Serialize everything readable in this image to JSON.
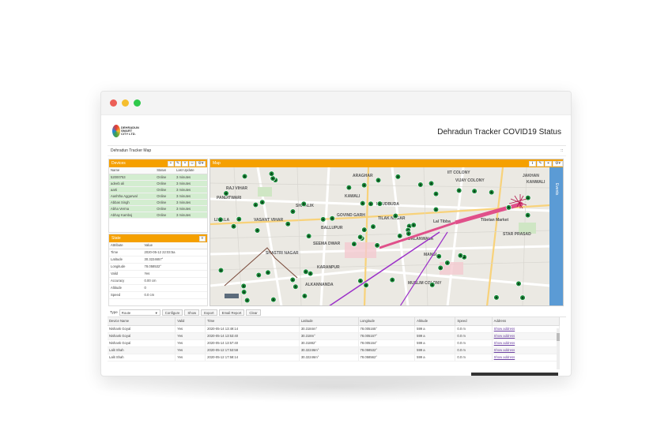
{
  "window": {
    "dots": [
      "#ec5f57",
      "#f5be2f",
      "#2fc94b"
    ]
  },
  "header": {
    "brand_line1": "DEHRADUN",
    "brand_line2": "SMART CITY LTD.",
    "title": "Dehradun Tracker COVID19 Status"
  },
  "subheader": {
    "title": "Dehradun Tracker Map",
    "expand_icon": "::"
  },
  "devices": {
    "title": "Devices",
    "columns": [
      "Name",
      "Status",
      "Last Update"
    ],
    "rows": [
      [
        "52000753",
        "Online",
        "3 minutes"
      ],
      [
        "adeeb ali",
        "Online",
        "3 minutes"
      ],
      [
        "aarti",
        "Online",
        "3 minutes"
      ],
      [
        "Aashtha Aggarwal",
        "Online",
        "3 minutes"
      ],
      [
        "Abbas Singh",
        "Online",
        "3 minutes"
      ],
      [
        "Abha Verma",
        "Online",
        "3 minutes"
      ],
      [
        "Abhay Kamboj",
        "Online",
        "3 minutes"
      ]
    ]
  },
  "state": {
    "title": "State",
    "columns": [
      "Attribute",
      "Value"
    ],
    "rows": [
      [
        "Time",
        "2020-05-12 22:03:5a"
      ],
      [
        "Latitude",
        "30.3224657°"
      ],
      [
        "Longitude",
        "78.058532°"
      ],
      [
        "Valid",
        "Yes"
      ],
      [
        "Accuracy",
        "0.00 cm"
      ],
      [
        "Altitude",
        "0"
      ],
      [
        "Speed",
        "0.0 cm"
      ]
    ]
  },
  "map": {
    "title": "Map",
    "events_label": "Events",
    "labels": [
      "JAKHAN",
      "RAJ VIHAR",
      "LIWALA",
      "VASANT VIHAR",
      "SHIVALIK",
      "PANDITWARI",
      "KAWALI",
      "GOVIND GARH",
      "TILAK NAGAR",
      "KANWALI",
      "BALLUPUR",
      "SHASTRI NAGAR",
      "ALKANNANDA",
      "KARANPUR",
      "DALANWALA",
      "MUSLIM COLONY",
      "MANSI",
      "ARAGHAR",
      "VIJAY COLONY",
      "SEEMA DWAR",
      "IIT COLONY",
      "STAR PRASAD",
      "Lal Tibba",
      "Tibetan Market",
      "KHUDBUDA"
    ]
  },
  "report": {
    "type_label": "Type",
    "type_value": "Route",
    "buttons": [
      "Configure",
      "Show",
      "Export",
      "Email Report",
      "Clear"
    ],
    "columns": [
      "Device Name",
      "Valid",
      "Time",
      "Latitude",
      "Longitude",
      "Altitude",
      "Speed",
      "Address"
    ],
    "rows": [
      [
        "Nishank Goyal",
        "Yes",
        "2020-05-14 13:49:14",
        "30.3184m°",
        "78.005165°",
        "599 a",
        "0.0 m",
        "Show address"
      ],
      [
        "Nishank Goyal",
        "Yes",
        "2020-05-14 13:53:40",
        "30.318m°",
        "78.005167°",
        "599 a",
        "0.0 m",
        "Show address"
      ],
      [
        "Nishank Goyal",
        "Yes",
        "2020-05-14 13:57:40",
        "30.31882°",
        "78.005164°",
        "599 a",
        "0.0 m",
        "Show address"
      ],
      [
        "Lalit Shah",
        "Yes",
        "2020-05-12 17:53:58",
        "30.32246m°",
        "78.058532°",
        "599 a",
        "0.0 m",
        "Show address"
      ],
      [
        "Lalit Shah",
        "Yes",
        "2020-05-12 17:58:14",
        "30.32246m°",
        "78.058562°",
        "599 a",
        "0.0 m",
        "Show address"
      ]
    ]
  },
  "colors": {
    "accent_orange": "#f5a000",
    "online_row": "#d3edd0",
    "events_blue": "#5b9bd5",
    "route_pink": "#e0508a",
    "route_purple": "#9b30c8"
  }
}
